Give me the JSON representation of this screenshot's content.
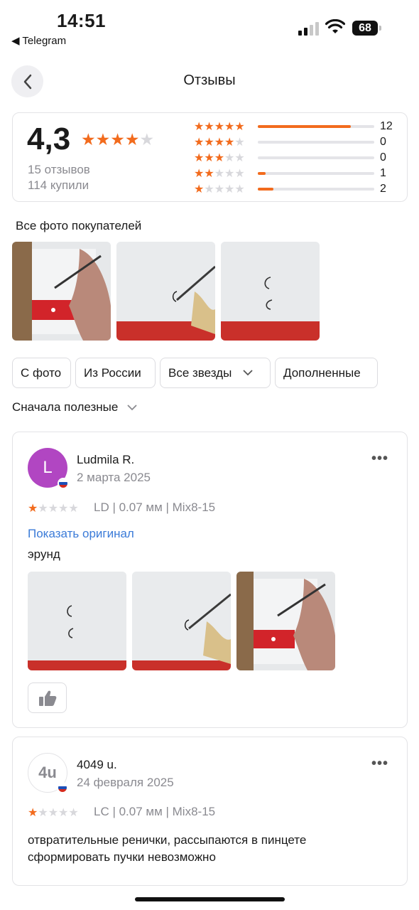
{
  "status_bar": {
    "time": "14:51",
    "back_app": "◀ Telegram",
    "battery": "68"
  },
  "header": {
    "title": "Отзывы",
    "back_icon": "chevron-left-icon"
  },
  "summary": {
    "rating": "4,3",
    "stars_filled": 4,
    "reviews_count": "15 отзывов",
    "buyers_count": "114 купили",
    "distribution": [
      {
        "stars": 5,
        "count": "12",
        "fraction": 0.8
      },
      {
        "stars": 4,
        "count": "0",
        "fraction": 0
      },
      {
        "stars": 3,
        "count": "0",
        "fraction": 0
      },
      {
        "stars": 2,
        "count": "1",
        "fraction": 0.067
      },
      {
        "stars": 1,
        "count": "2",
        "fraction": 0.133
      }
    ]
  },
  "photos_section": {
    "label": "Все фото покупателей"
  },
  "filters": {
    "chips": [
      "С фото",
      "Из России",
      "Все звезды",
      "Дополненные"
    ],
    "sort_label": "Сначала полезные"
  },
  "reviews": [
    {
      "avatar_letter": "L",
      "name": "Ludmila R.",
      "date": "2 марта 2025",
      "stars": 1,
      "variant": "LD | 0.07 мм | Mix8-15",
      "show_original": "Показать оригинал",
      "text": "эрунд"
    },
    {
      "avatar_letter": "4u",
      "name": "4049 u.",
      "date": "24 февраля 2025",
      "stars": 1,
      "variant": "LC | 0.07 мм | Mix8-15",
      "text": "отвратительные ренички, рассыпаются в пинцете сформировать пучки невозможно"
    }
  ],
  "colors": {
    "accent_star": "#f26b1d",
    "link": "#3b7bd8",
    "avatar_purple": "#b146c2"
  }
}
